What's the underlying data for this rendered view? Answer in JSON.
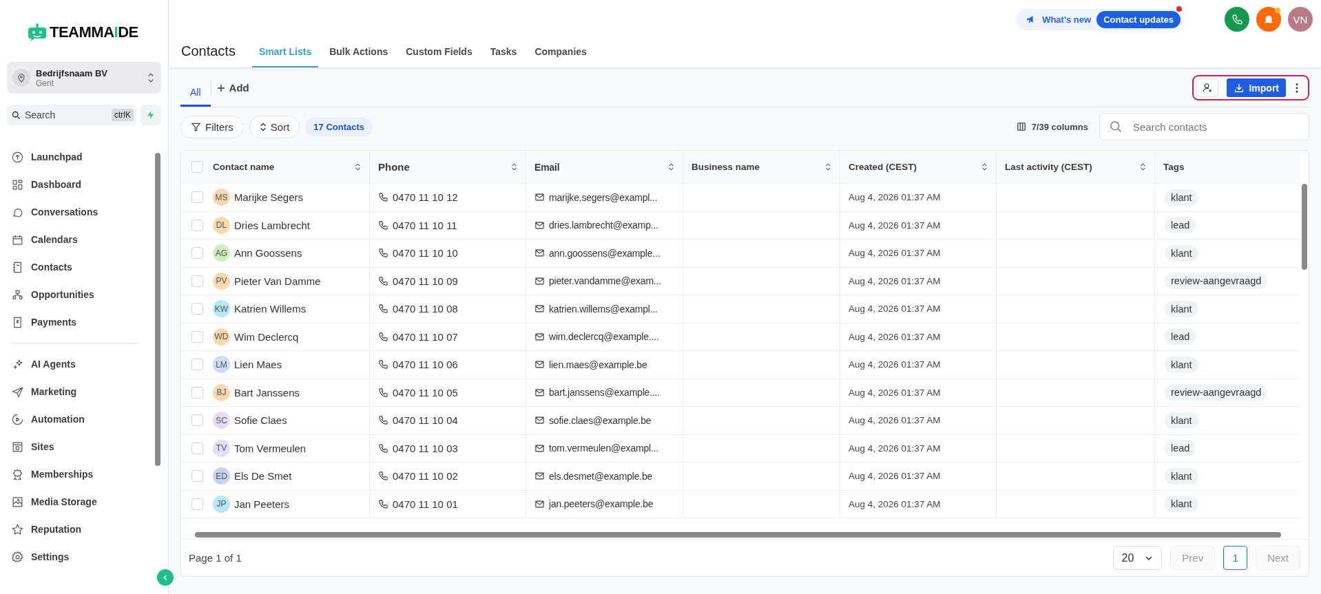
{
  "logo": {
    "before": "TEAMMA",
    "accent": "I",
    "after": "DE"
  },
  "account": {
    "name": "Bedrijfsnaam BV",
    "location": "Gent"
  },
  "sidebar_search": {
    "placeholder": "Search",
    "shortcut": "ctrlK"
  },
  "nav_groups": [
    [
      {
        "label": "Launchpad",
        "selected": false
      },
      {
        "label": "Dashboard",
        "selected": false
      },
      {
        "label": "Conversations",
        "selected": false
      },
      {
        "label": "Calendars",
        "selected": false
      },
      {
        "label": "Contacts",
        "selected": false
      },
      {
        "label": "Opportunities",
        "selected": false
      },
      {
        "label": "Payments",
        "selected": false
      }
    ],
    [
      {
        "label": "AI Agents",
        "selected": false
      },
      {
        "label": "Marketing",
        "selected": false
      },
      {
        "label": "Automation",
        "selected": false
      },
      {
        "label": "Sites",
        "selected": false
      },
      {
        "label": "Memberships",
        "selected": false
      },
      {
        "label": "Media Storage",
        "selected": false
      },
      {
        "label": "Reputation",
        "selected": false
      },
      {
        "label": "Settings",
        "selected": false
      }
    ]
  ],
  "announce": {
    "label": "What's new",
    "badge": "Contact updates"
  },
  "user": {
    "initials": "VN"
  },
  "page_title": "Contacts",
  "tabs": [
    {
      "label": "Smart Lists",
      "selected": true
    },
    {
      "label": "Bulk Actions",
      "selected": false
    },
    {
      "label": "Custom Fields",
      "selected": false
    },
    {
      "label": "Tasks",
      "selected": false
    },
    {
      "label": "Companies",
      "selected": false
    }
  ],
  "lists": [
    {
      "label": "All",
      "selected": true
    }
  ],
  "add_list": "Add",
  "import_button": "Import",
  "filters": "Filters",
  "sort": "Sort",
  "count": "17 Contacts",
  "columns_label": "7/39 columns",
  "search": {
    "placeholder": "Search contacts"
  },
  "table": {
    "select_all": {
      "checked": false
    },
    "columns": [
      {
        "label": "Contact name",
        "sortable": true
      },
      {
        "label": "Phone",
        "sortable": true
      },
      {
        "label": "Email",
        "sortable": true
      },
      {
        "label": "Business name",
        "sortable": true
      },
      {
        "label": "Created (CEST)",
        "sortable": true
      },
      {
        "label": "Last activity (CEST)",
        "sortable": true
      },
      {
        "label": "Tags",
        "sortable": false
      }
    ],
    "rows": [
      {
        "checked": false,
        "initials": "MS",
        "color": "#fbd9b0",
        "name": "Marijke Segers",
        "phone": "0470 11 10 12",
        "email": "marijke.segers@exampl...",
        "created": "Aug 4, 2026 01:37 AM",
        "tag": "klant"
      },
      {
        "checked": false,
        "initials": "DL",
        "color": "#fbd9b0",
        "name": "Dries Lambrecht",
        "phone": "0470 11 10 11",
        "email": "dries.lambrecht@examp...",
        "created": "Aug 4, 2026 01:37 AM",
        "tag": "lead"
      },
      {
        "checked": false,
        "initials": "AG",
        "color": "#cdeec0",
        "name": "Ann Goossens",
        "phone": "0470 11 10 10",
        "email": "ann.goossens@example...",
        "created": "Aug 4, 2026 01:37 AM",
        "tag": "klant"
      },
      {
        "checked": false,
        "initials": "PV",
        "color": "#fbd9b0",
        "name": "Pieter Van Damme",
        "phone": "0470 11 10 09",
        "email": "pieter.vandamme@exam...",
        "created": "Aug 4, 2026 01:37 AM",
        "tag": "review-aangevraagd"
      },
      {
        "checked": false,
        "initials": "KW",
        "color": "#b6e8f5",
        "name": "Katrien Willems",
        "phone": "0470 11 10 08",
        "email": "katrien.willems@exampl...",
        "created": "Aug 4, 2026 01:37 AM",
        "tag": "klant"
      },
      {
        "checked": false,
        "initials": "WD",
        "color": "#fbd9b0",
        "name": "Wim Declercq",
        "phone": "0470 11 10 07",
        "email": "wim.declercq@example....",
        "created": "Aug 4, 2026 01:37 AM",
        "tag": "lead"
      },
      {
        "checked": false,
        "initials": "LM",
        "color": "#cfdcf7",
        "name": "Lien Maes",
        "phone": "0470 11 10 06",
        "email": "lien.maes@example.be",
        "created": "Aug 4, 2026 01:37 AM",
        "tag": "klant"
      },
      {
        "checked": false,
        "initials": "BJ",
        "color": "#fbd9b0",
        "name": "Bart Janssens",
        "phone": "0470 11 10 05",
        "email": "bart.janssens@example....",
        "created": "Aug 4, 2026 01:37 AM",
        "tag": "review-aangevraagd"
      },
      {
        "checked": false,
        "initials": "SC",
        "color": "#e4ddf5",
        "name": "Sofie Claes",
        "phone": "0470 11 10 04",
        "email": "sofie.claes@example.be",
        "created": "Aug 4, 2026 01:37 AM",
        "tag": "klant"
      },
      {
        "checked": false,
        "initials": "TV",
        "color": "#e4ddf5",
        "name": "Tom Vermeulen",
        "phone": "0470 11 10 03",
        "email": "tom.vermeulen@exampl...",
        "created": "Aug 4, 2026 01:37 AM",
        "tag": "lead"
      },
      {
        "checked": false,
        "initials": "ED",
        "color": "#c4d4ee",
        "name": "Els De Smet",
        "phone": "0470 11 10 02",
        "email": "els.desmet@example.be",
        "created": "Aug 4, 2026 01:37 AM",
        "tag": "klant"
      },
      {
        "checked": false,
        "initials": "JP",
        "color": "#b6e8f5",
        "name": "Jan Peeters",
        "phone": "0470 11 10 01",
        "email": "jan.peeters@example.be",
        "created": "Aug 4, 2026 01:37 AM",
        "tag": "klant"
      }
    ]
  },
  "pagination": {
    "summary": "Page 1 of 1",
    "page_size": "20",
    "prev": "Prev",
    "next": "Next",
    "pages": [
      {
        "label": "1",
        "selected": true
      }
    ]
  }
}
